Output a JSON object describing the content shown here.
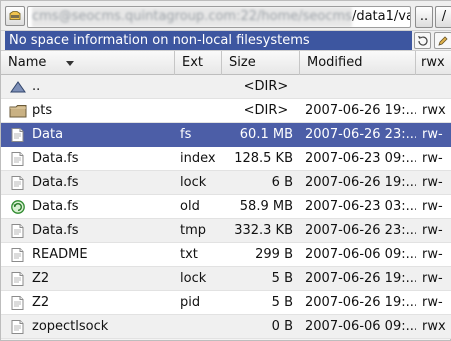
{
  "path_bar": {
    "blurred_prefix": "cms@seocms.quintagroup.com:22/home/seocms",
    "visible_path": "/data1/var",
    "dots_label": "..",
    "slash_label": "/"
  },
  "status": {
    "message": "No space information on non-local filesystems"
  },
  "table": {
    "headers": {
      "name": "Name",
      "ext": "Ext",
      "size": "Size",
      "modified": "Modified",
      "rwx": "rwx"
    },
    "rows": [
      {
        "name": "..",
        "ext": "",
        "size": "<DIR>",
        "modified": "",
        "rwx": "",
        "icon": "up-icon"
      },
      {
        "name": "pts",
        "ext": "",
        "size": "<DIR>",
        "modified": "2007-06-26 19:...",
        "rwx": "rwx",
        "icon": "folder-icon"
      },
      {
        "name": "Data",
        "ext": "fs",
        "size": "60.1 MB",
        "modified": "2007-06-26 23:...",
        "rwx": "rw-",
        "icon": "document-icon"
      },
      {
        "name": "Data.fs",
        "ext": "index",
        "size": "128.5 KB",
        "modified": "2007-06-23 09:...",
        "rwx": "rw-",
        "icon": "document-icon"
      },
      {
        "name": "Data.fs",
        "ext": "lock",
        "size": "6 B",
        "modified": "2007-06-26 19:...",
        "rwx": "rw-",
        "icon": "document-icon"
      },
      {
        "name": "Data.fs",
        "ext": "old",
        "size": "58.9 MB",
        "modified": "2007-06-23 03:...",
        "rwx": "rw-",
        "icon": "refresh-icon"
      },
      {
        "name": "Data.fs",
        "ext": "tmp",
        "size": "332.3 KB",
        "modified": "2007-06-26 23:...",
        "rwx": "rw-",
        "icon": "document-icon"
      },
      {
        "name": "README",
        "ext": "txt",
        "size": "299 B",
        "modified": "2007-06-06 09:...",
        "rwx": "rw-",
        "icon": "document-icon"
      },
      {
        "name": "Z2",
        "ext": "lock",
        "size": "5 B",
        "modified": "2007-06-26 19:...",
        "rwx": "rw-",
        "icon": "document-icon"
      },
      {
        "name": "Z2",
        "ext": "pid",
        "size": "5 B",
        "modified": "2007-06-26 19:...",
        "rwx": "rw-",
        "icon": "document-icon"
      },
      {
        "name": "zopectlsock",
        "ext": "",
        "size": "0 B",
        "modified": "2007-06-06 09:...",
        "rwx": "rwx",
        "icon": "document-icon"
      }
    ]
  },
  "colors": {
    "selection": "#4c5ea7",
    "status_background": "#3d56a0"
  },
  "icons": {
    "drive": "drive-icon",
    "status_left": "refresh-view-icon",
    "status_right": "edit-icon"
  }
}
